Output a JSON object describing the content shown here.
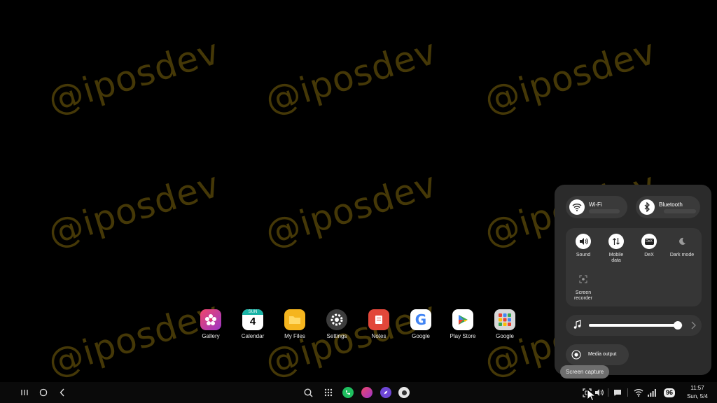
{
  "watermark": "@iposdev",
  "dock": {
    "apps": [
      {
        "label": "Gallery",
        "icon": "gallery-icon",
        "color": "#e0386d"
      },
      {
        "label": "Calendar",
        "icon": "calendar-icon",
        "color": "#ffffff",
        "date": "4",
        "header": "SUN"
      },
      {
        "label": "My Files",
        "icon": "my-files-icon",
        "color": "#f5b51e"
      },
      {
        "label": "Settings",
        "icon": "settings-icon",
        "color": "#3c3c3c"
      },
      {
        "label": "Notes",
        "icon": "notes-icon",
        "color": "#e2473a"
      },
      {
        "label": "Google",
        "icon": "google-icon",
        "color": "#ffffff"
      },
      {
        "label": "Play Store",
        "icon": "play-store-icon",
        "color": "#ffffff"
      },
      {
        "label": "Google",
        "icon": "google-folder-icon",
        "color": "#d8d8d8"
      }
    ]
  },
  "quick_panel": {
    "wifi_label": "Wi-Fi",
    "bluetooth_label": "Bluetooth",
    "tiles": [
      {
        "label": "Sound",
        "icon": "sound-icon"
      },
      {
        "label": "Mobile data",
        "icon": "mobile-data-icon"
      },
      {
        "label": "DeX",
        "icon": "dex-icon"
      },
      {
        "label": "Dark mode",
        "icon": "dark-mode-icon"
      },
      {
        "label": "Screen recorder",
        "icon": "screen-recorder-icon"
      }
    ],
    "volume_level": 0.95,
    "media_output_label": "Media output"
  },
  "tooltip": "Screen capture",
  "taskbar": {
    "battery": "96",
    "time": "11:57",
    "date": "Sun, 5/4"
  }
}
